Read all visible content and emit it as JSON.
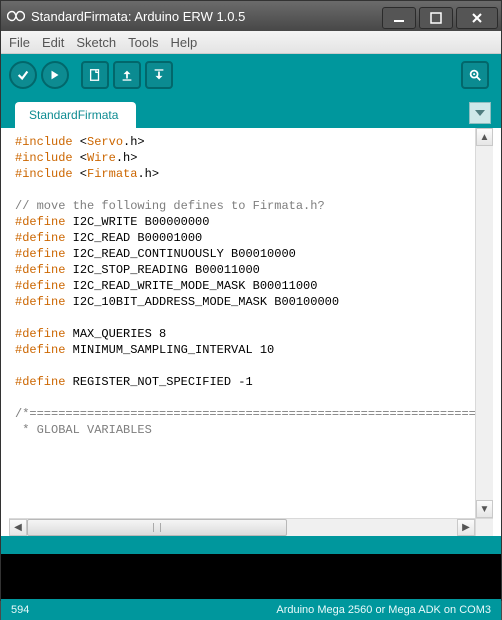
{
  "window": {
    "title": "StandardFirmata: Arduino ERW 1.0.5"
  },
  "menu": {
    "file": "File",
    "edit": "Edit",
    "sketch": "Sketch",
    "tools": "Tools",
    "help": "Help"
  },
  "tab": {
    "name": "StandardFirmata"
  },
  "code": {
    "l1a": "#include",
    "l1b": " <",
    "l1c": "Servo",
    "l1d": ".h>",
    "l2a": "#include",
    "l2b": " <",
    "l2c": "Wire",
    "l2d": ".h>",
    "l3a": "#include",
    "l3b": " <",
    "l3c": "Firmata",
    "l3d": ".h>",
    "blank1": "",
    "l4": "// move the following defines to Firmata.h?",
    "l5a": "#define",
    "l5b": " I2C_WRITE B00000000",
    "l6a": "#define",
    "l6b": " I2C_READ B00001000",
    "l7a": "#define",
    "l7b": " I2C_READ_CONTINUOUSLY B00010000",
    "l8a": "#define",
    "l8b": " I2C_STOP_READING B00011000",
    "l9a": "#define",
    "l9b": " I2C_READ_WRITE_MODE_MASK B00011000",
    "l10a": "#define",
    "l10b": " I2C_10BIT_ADDRESS_MODE_MASK B00100000",
    "blank2": "",
    "l11a": "#define",
    "l11b": " MAX_QUERIES 8",
    "l12a": "#define",
    "l12b": " MINIMUM_SAMPLING_INTERVAL 10",
    "blank3": "",
    "l13a": "#define",
    "l13b": " REGISTER_NOT_SPECIFIED -1",
    "blank4": "",
    "l14": "/*==============================================================================",
    "l15": " * GLOBAL VARIABLES"
  },
  "status": {
    "left": "594",
    "right": "Arduino Mega 2560 or Mega ADK on COM3"
  }
}
